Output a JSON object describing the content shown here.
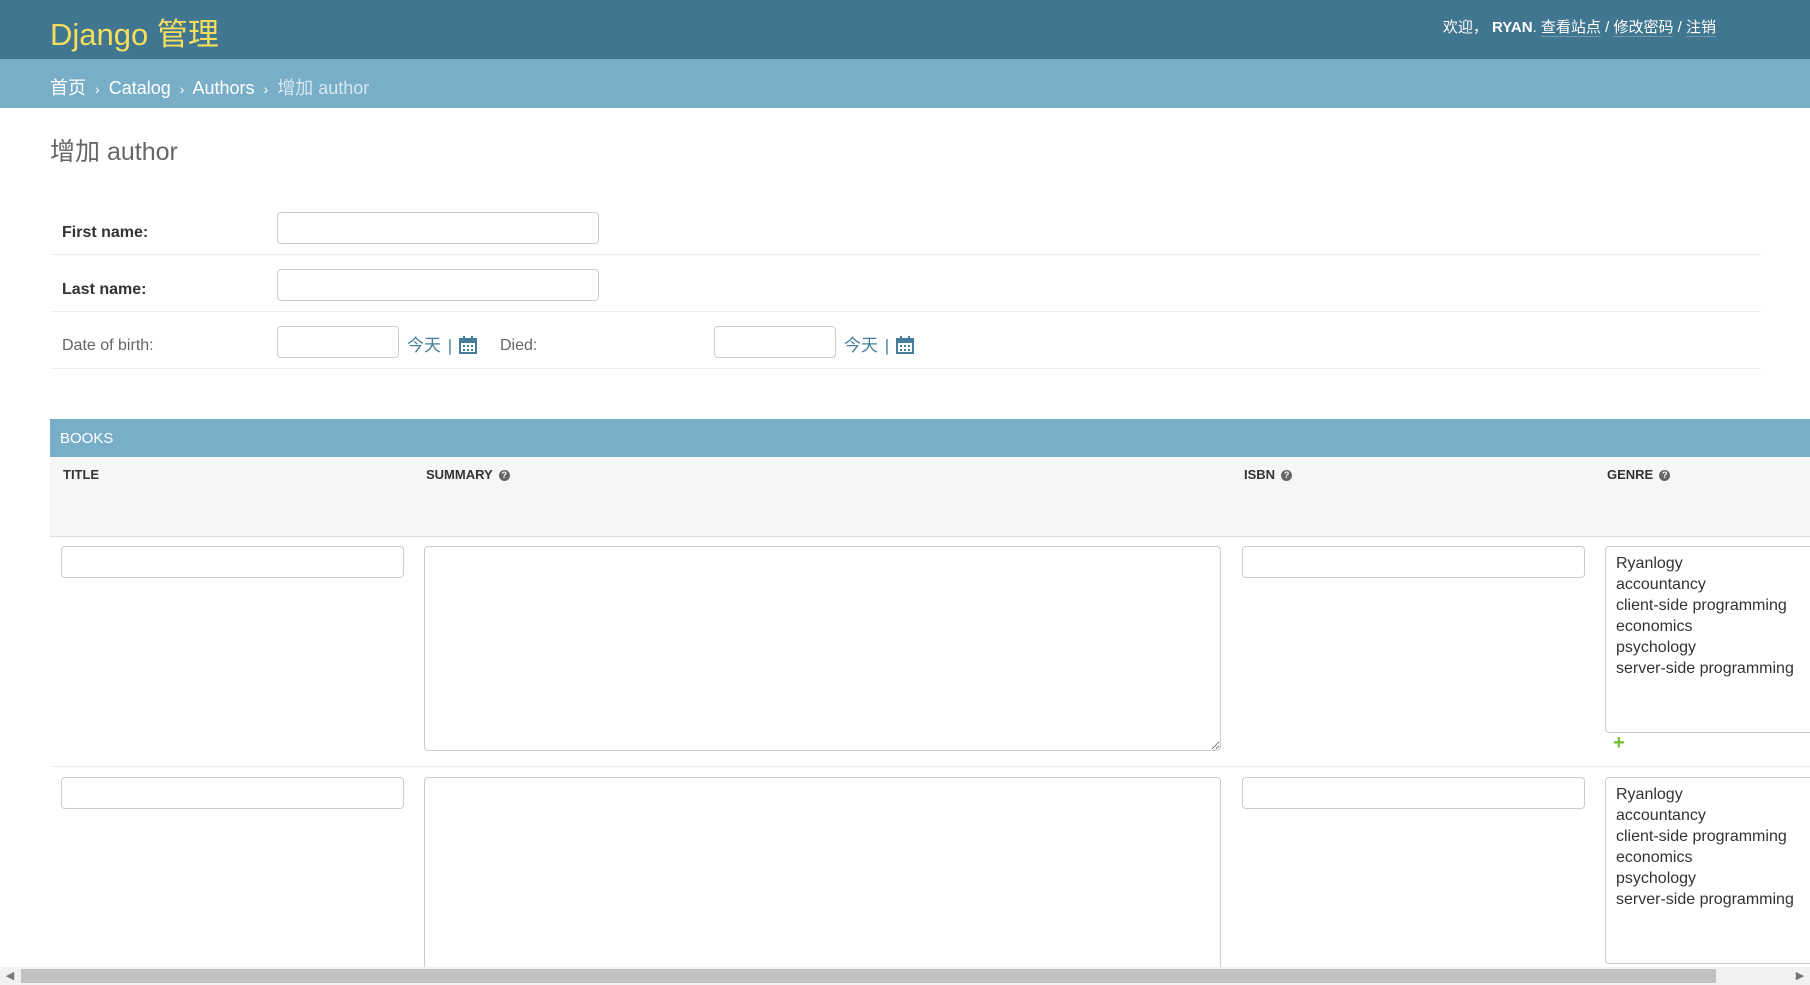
{
  "header": {
    "branding": "Django 管理",
    "user_tools": {
      "welcome": "欢迎，",
      "username": "RYAN",
      "period": ".",
      "view_site": "查看站点",
      "sep1": "/",
      "change_password": "修改密码",
      "sep2": "/",
      "logout": "注销"
    }
  },
  "breadcrumbs": {
    "home": "首页",
    "sep": "›",
    "catalog": "Catalog",
    "authors": "Authors",
    "current": "增加 author"
  },
  "page_title": "增加 author",
  "form": {
    "first_name": {
      "label": "First name:",
      "value": ""
    },
    "last_name": {
      "label": "Last name:",
      "value": ""
    },
    "date_of_birth": {
      "label": "Date of birth:",
      "value": "",
      "today": "今天",
      "pipe": "|"
    },
    "died": {
      "label": "Died:",
      "value": "",
      "today": "今天",
      "pipe": "|"
    }
  },
  "inline": {
    "title": "BOOKS",
    "columns": {
      "title": "TITLE",
      "summary": "SUMMARY",
      "isbn": "ISBN",
      "genre": "GENRE"
    },
    "help_glyph": "?",
    "add_glyph": "+",
    "genres": [
      "Ryanlogy",
      "accountancy",
      "client-side programming",
      "economics",
      "psychology",
      "server-side programming"
    ]
  },
  "scrollbar": {
    "left_arrow": "◀",
    "right_arrow": "▶"
  },
  "colors": {
    "header_bg": "#417690",
    "branding": "#f5dd5d",
    "breadcrumbs_bg": "#79aec8",
    "link": "#447e9b",
    "add_green": "#70bf2b"
  },
  "icons": [
    "calendar-icon",
    "help-icon",
    "add-icon"
  ]
}
